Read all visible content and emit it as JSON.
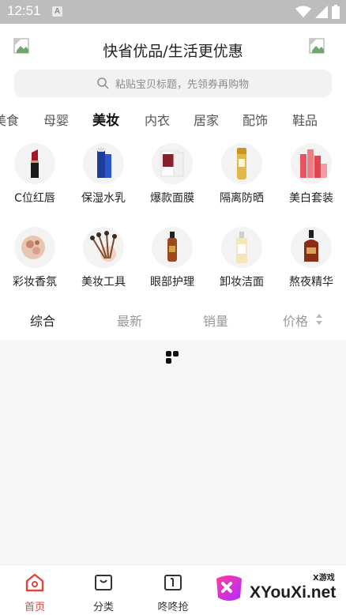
{
  "status_bar": {
    "time": "12:51",
    "indicator": "A"
  },
  "header": {
    "title": "快省优品/生活更优惠"
  },
  "search": {
    "placeholder": "粘贴宝贝标题，先领券再购物"
  },
  "categories": [
    "美食",
    "母婴",
    "美妆",
    "内衣",
    "居家",
    "配饰",
    "鞋品"
  ],
  "active_category": "美妆",
  "grid": [
    {
      "label": "C位红唇",
      "icon": "lipstick-icon"
    },
    {
      "label": "保湿水乳",
      "icon": "lotion-icon"
    },
    {
      "label": "爆款面膜",
      "icon": "face-mask-icon"
    },
    {
      "label": "隔离防晒",
      "icon": "sunscreen-icon"
    },
    {
      "label": "美白套装",
      "icon": "whitening-set-icon"
    },
    {
      "label": "彩妆香氛",
      "icon": "makeup-palette-icon"
    },
    {
      "label": "美妆工具",
      "icon": "makeup-brushes-icon"
    },
    {
      "label": "眼部护理",
      "icon": "eye-care-icon"
    },
    {
      "label": "卸妆洁面",
      "icon": "cleanser-icon"
    },
    {
      "label": "熬夜精华",
      "icon": "serum-icon"
    }
  ],
  "sort": {
    "comprehensive": "综合",
    "newest": "最新",
    "sales": "销量",
    "price": "价格"
  },
  "bottom_nav": [
    {
      "label": "首页",
      "icon": "home-icon"
    },
    {
      "label": "分类",
      "icon": "category-bag-icon"
    },
    {
      "label": "咚咚抢",
      "icon": "flash-sale-icon"
    }
  ],
  "watermark": {
    "text": "XYouXi.net",
    "small": "X游戏"
  },
  "colors": {
    "accent": "#e2453b",
    "status_bar": "#bdbdbd",
    "search_bg": "#f2f2f2",
    "content_bg": "#f7f7f7"
  }
}
